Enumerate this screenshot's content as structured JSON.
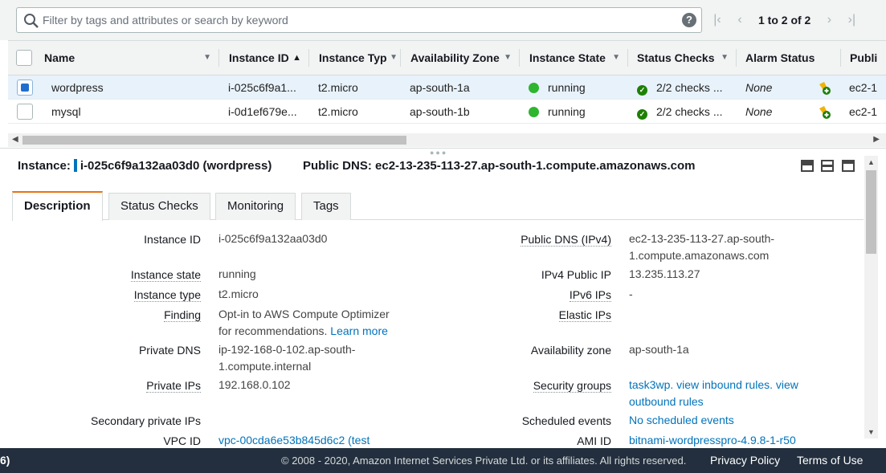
{
  "search": {
    "placeholder": "Filter by tags and attributes or search by keyword",
    "help": "?"
  },
  "pager": {
    "first": "|<",
    "prev": "<",
    "text": "1 to 2 of 2",
    "next": ">",
    "last": ">|"
  },
  "columns": [
    "Name",
    "Instance ID",
    "Instance Typ",
    "Availability Zone",
    "Instance State",
    "Status Checks",
    "Alarm Status",
    "Publi"
  ],
  "rows": [
    {
      "name": "wordpress",
      "instance_id": "i-025c6f9a1...",
      "type": "t2.micro",
      "zone": "ap-south-1a",
      "state": "running",
      "checks": "2/2 checks ...",
      "alarm": "None",
      "public": "ec2-1",
      "selected": true
    },
    {
      "name": "mysql",
      "instance_id": "i-0d1ef679e...",
      "type": "t2.micro",
      "zone": "ap-south-1b",
      "state": "running",
      "checks": "2/2 checks ...",
      "alarm": "None",
      "public": "ec2-1",
      "selected": false
    }
  ],
  "detail": {
    "instance_label": "Instance:",
    "instance_value": "i-025c6f9a132aa03d0 (wordpress)",
    "dns_label": "Public DNS:",
    "dns_value": "ec2-13-235-113-27.ap-south-1.compute.amazonaws.com",
    "tabs": [
      "Description",
      "Status Checks",
      "Monitoring",
      "Tags"
    ],
    "left": {
      "instance_id": {
        "label": "Instance ID",
        "value": "i-025c6f9a132aa03d0"
      },
      "instance_state": {
        "label": "Instance state",
        "value": "running"
      },
      "instance_type": {
        "label": "Instance type",
        "value": "t2.micro"
      },
      "finding": {
        "label": "Finding",
        "value": "Opt-in to AWS Compute Optimizer for recommendations.",
        "link": "Learn more"
      },
      "private_dns": {
        "label": "Private DNS",
        "line1": "ip-192-168-0-102.ap-south-",
        "line2": "1.compute.internal"
      },
      "private_ips": {
        "label": "Private IPs",
        "value": "192.168.0.102"
      },
      "secondary_ips": {
        "label": "Secondary private IPs",
        "value": ""
      },
      "vpc_id": {
        "label": "VPC ID",
        "value": "vpc-00cda6e53b845d6c2 (test"
      }
    },
    "right": {
      "public_dns": {
        "label": "Public DNS (IPv4)",
        "line1": "ec2-13-235-113-27.ap-south-",
        "line2": "1.compute.amazonaws.com"
      },
      "ipv4_public": {
        "label": "IPv4 Public IP",
        "value": "13.235.113.27"
      },
      "ipv6": {
        "label": "IPv6 IPs",
        "value": "-"
      },
      "elastic": {
        "label": "Elastic IPs",
        "value": ""
      },
      "az": {
        "label": "Availability zone",
        "value": "ap-south-1a"
      },
      "sg": {
        "label": "Security groups",
        "link1": "task3wp.",
        "link2": "view inbound rules.",
        "link3": "view",
        "link4": "outbound rules"
      },
      "scheduled": {
        "label": "Scheduled events",
        "value": "No scheduled events"
      },
      "ami": {
        "label": "AMI ID",
        "value": "bitnami-wordpresspro-4.9.8-1-r50"
      }
    }
  },
  "footer": {
    "left": "6)",
    "copyright": "© 2008 - 2020, Amazon Internet Services Private Ltd. or its affiliates. All rights reserved.",
    "privacy": "Privacy Policy",
    "terms": "Terms of Use"
  },
  "colors": {
    "accent": "#ec7211",
    "link": "#0073bb",
    "running": "#2fb52f",
    "footer_bg": "#232f3e"
  }
}
